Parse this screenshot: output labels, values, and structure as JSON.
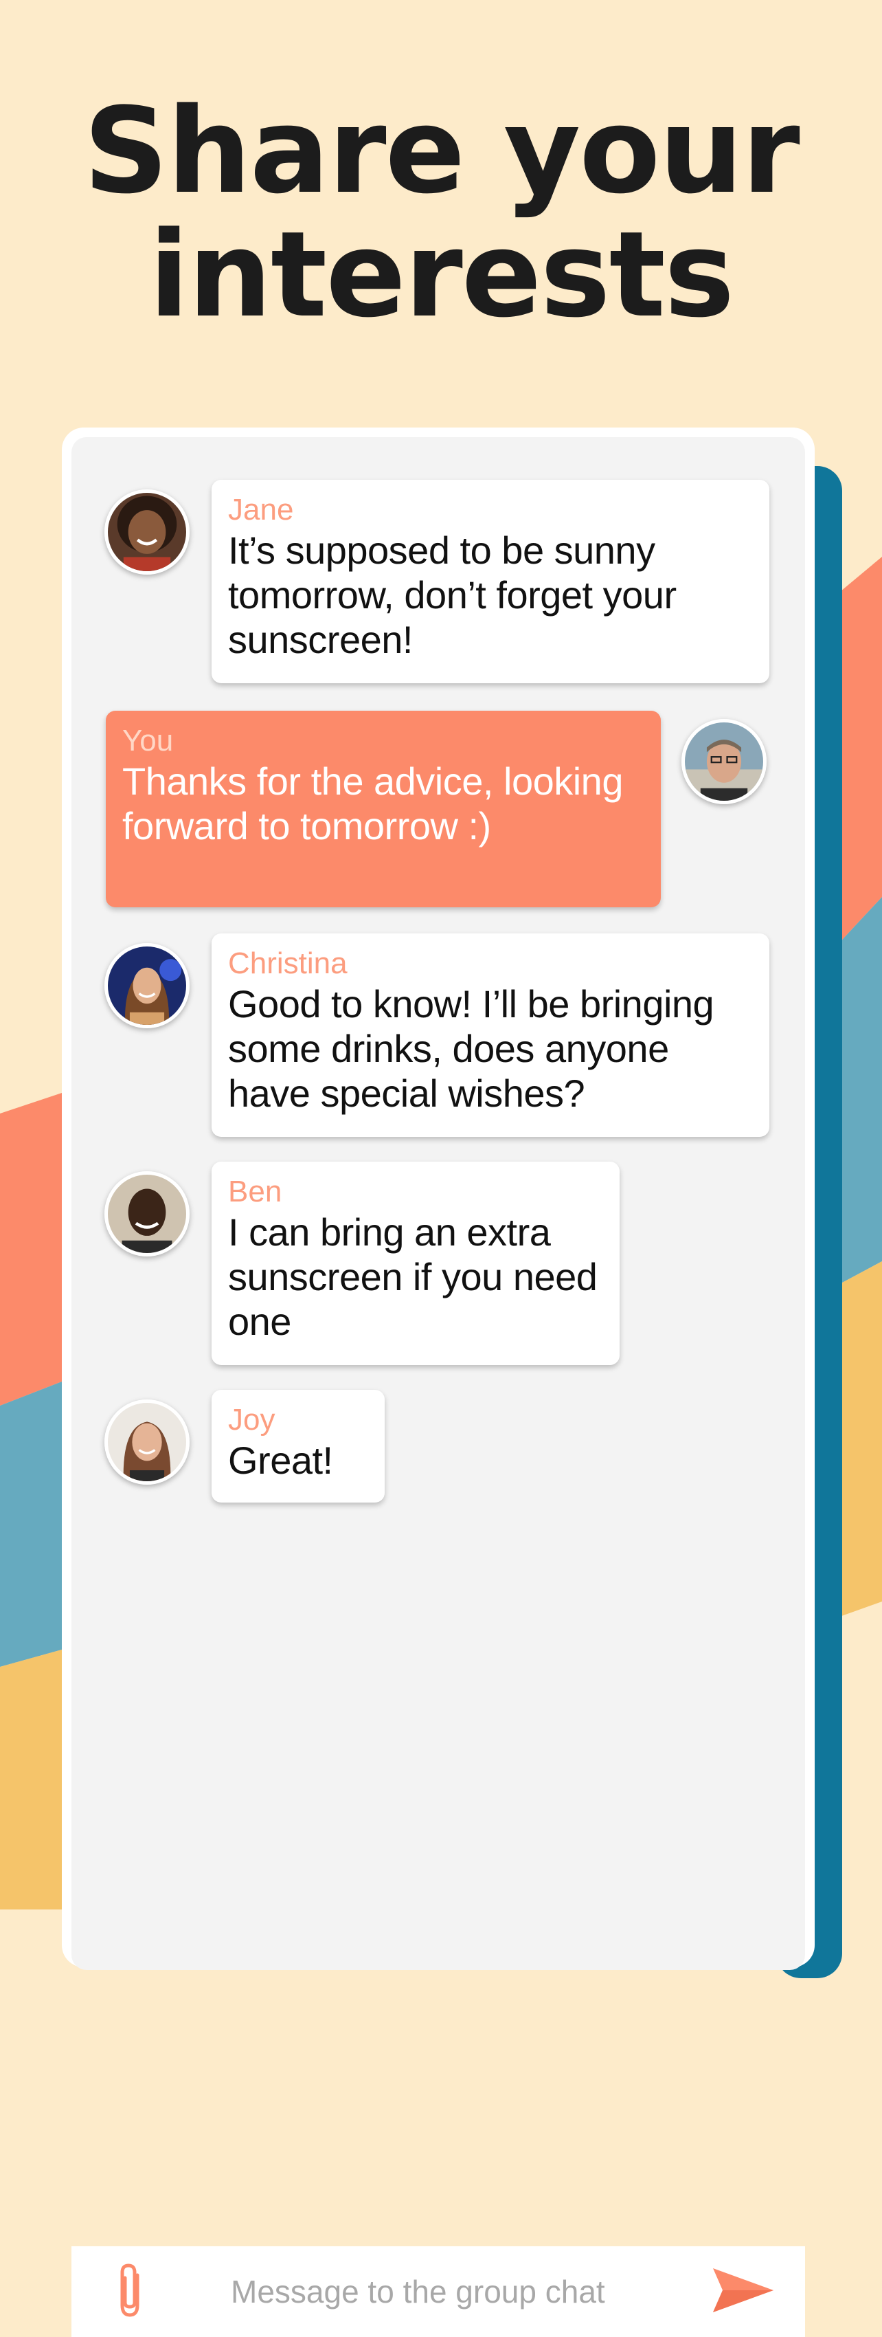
{
  "headline": {
    "line1": "Share your",
    "line2": "interests"
  },
  "colors": {
    "background": "#fdebca",
    "accent_coral": "#fc8a6a",
    "accent_teal": "#10769a",
    "accent_blue": "#66aabf",
    "accent_yellow": "#f5c46a",
    "sender_name": "#fc9d7f"
  },
  "chat": {
    "messages": [
      {
        "sender": "Jane",
        "text": "It’s supposed to be sunny tomorrow, don’t forget your sunscreen!",
        "avatar": "jane-avatar"
      },
      {
        "sender": "You",
        "text": "Thanks for the advice, looking forward to tomorrow :)",
        "avatar": "user-avatar"
      },
      {
        "sender": "Christina",
        "text": "Good to know! I’ll be bringing some drinks, does anyone have special wishes?",
        "avatar": "christina-avatar"
      },
      {
        "sender": "Ben",
        "text": "I can bring an extra sunscreen if you need one",
        "avatar": "ben-avatar"
      },
      {
        "sender": "Joy",
        "text": "Great!",
        "avatar": "joy-avatar"
      }
    ]
  },
  "input": {
    "placeholder": "Message to the group chat",
    "attach_icon": "paperclip-icon",
    "send_icon": "send-icon"
  }
}
